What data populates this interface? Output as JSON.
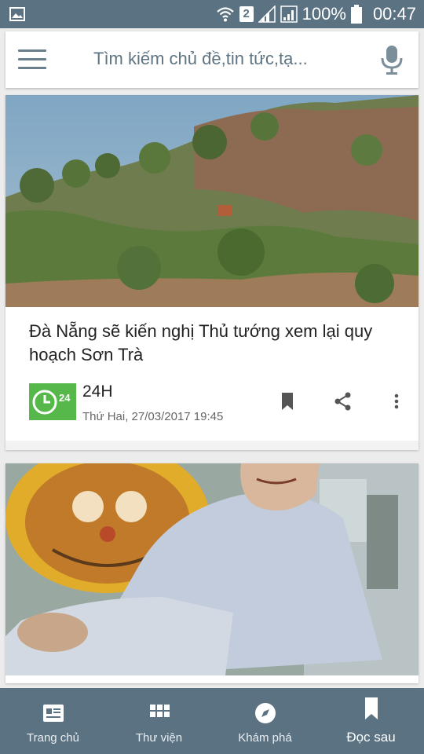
{
  "status_bar": {
    "sim_badge": "2",
    "battery": "100%",
    "time": "00:47",
    "icons": [
      "gallery-icon",
      "wifi-icon",
      "signal-icon",
      "battery-icon"
    ]
  },
  "search": {
    "placeholder": "Tìm kiếm chủ đề,tin tức,tạ..."
  },
  "articles": [
    {
      "title": "Đà Nẵng sẽ kiến nghị Thủ tướng xem lại quy hoạch Sơn Trà",
      "source": "24H",
      "logo_text": "24",
      "date": "Thứ Hai, 27/03/2017 19:45"
    },
    {
      "title": "",
      "source": "",
      "date": ""
    }
  ],
  "bottom_nav": {
    "items": [
      {
        "label": "Trang chủ",
        "icon": "newspaper-icon"
      },
      {
        "label": "Thư viện",
        "icon": "grid-icon"
      },
      {
        "label": "Khám phá",
        "icon": "compass-icon"
      },
      {
        "label": "Đọc sau",
        "icon": "bookmark-icon",
        "active": true
      }
    ]
  },
  "colors": {
    "primary": "#5b7282",
    "logo_green": "#56b84a"
  }
}
